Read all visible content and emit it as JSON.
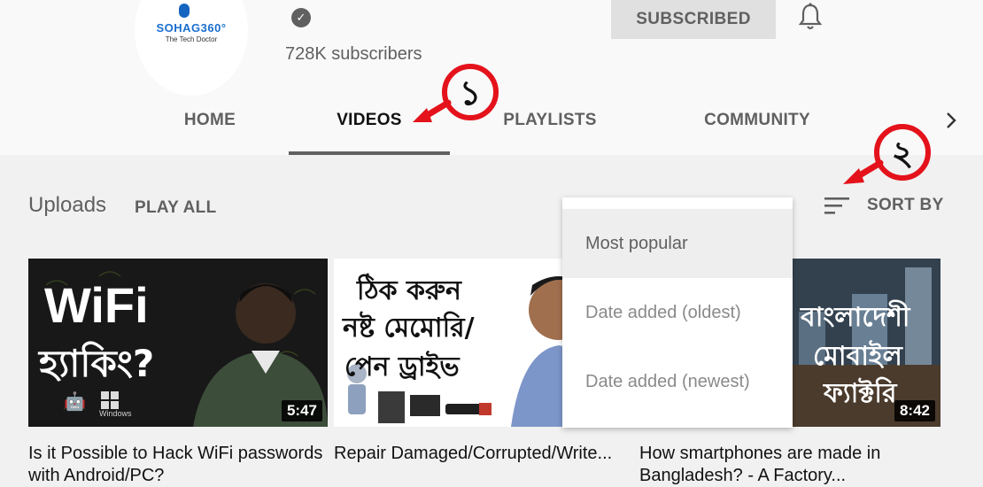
{
  "channel": {
    "brand_text": "SOHAG360°",
    "brand_tagline": "The Tech Doctor",
    "subscribers": "728K subscribers",
    "subscribe_label": "SUBSCRIBED"
  },
  "tabs": [
    {
      "label": "HOME"
    },
    {
      "label": "VIDEOS"
    },
    {
      "label": "PLAYLISTS"
    },
    {
      "label": "COMMUNITY"
    }
  ],
  "section": {
    "title": "Uploads",
    "play_all": "PLAY ALL",
    "sort_label": "SORT BY"
  },
  "sort_menu": {
    "options": [
      "Most popular",
      "Date added (oldest)",
      "Date added (newest)"
    ],
    "selected": "Most popular"
  },
  "annotations": {
    "marker_1": "১",
    "marker_2": "২"
  },
  "videos": [
    {
      "title": "Is it Possible to Hack WiFi passwords with Android/PC?",
      "duration": "5:47",
      "thumb_text_1": "WiFi",
      "thumb_text_2": "হ্যাকিং?",
      "thumb_os_label": "Windows"
    },
    {
      "title": "Repair Damaged/Corrupted/Write...",
      "duration": "",
      "thumb_text_1": "ঠিক করুন",
      "thumb_text_2": "নষ্ট মেমোরি/",
      "thumb_text_3": "পেন ড্রাইভ"
    },
    {
      "title": "How smartphones are made in Bangladesh? - A Factory...",
      "duration": "8:42",
      "thumb_text_1": "বাংলাদেশী",
      "thumb_text_2": "মোবাইল",
      "thumb_text_3": "ফ্যাক্টরি"
    }
  ],
  "colors": {
    "annotation_red": "#e4121b",
    "header_bg": "#f9f9f9",
    "page_bg": "#f1f1f1",
    "text_secondary": "#606060"
  },
  "icons": {
    "verified": "check-circle",
    "bell": "notification-bell",
    "tab_scroll": "chevron-right",
    "sort": "sort-lines"
  }
}
